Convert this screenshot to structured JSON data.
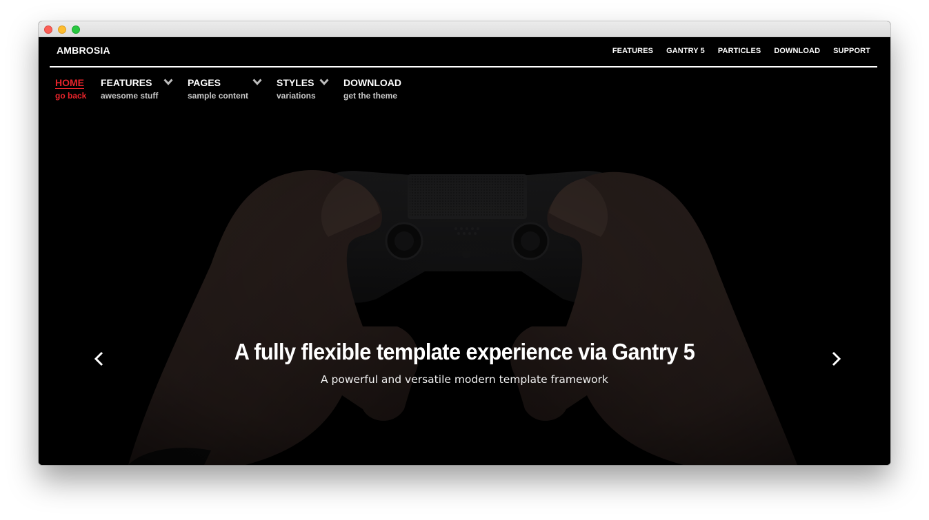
{
  "site": {
    "logo": "AMBROSIA"
  },
  "top_nav": {
    "links": [
      "FEATURES",
      "GANTRY 5",
      "PARTICLES",
      "DOWNLOAD",
      "SUPPORT"
    ]
  },
  "main_nav": {
    "items": [
      {
        "title": "HOME",
        "subtitle": "go back",
        "active": true,
        "has_dropdown": false
      },
      {
        "title": "FEATURES",
        "subtitle": "awesome stuff",
        "active": false,
        "has_dropdown": true
      },
      {
        "title": "PAGES",
        "subtitle": "sample content",
        "active": false,
        "has_dropdown": true
      },
      {
        "title": "STYLES",
        "subtitle": "variations",
        "active": false,
        "has_dropdown": true
      },
      {
        "title": "DOWNLOAD",
        "subtitle": "get the theme",
        "active": false,
        "has_dropdown": false
      }
    ]
  },
  "hero": {
    "title": "A fully flexible template experience via Gantry 5",
    "subtitle": "A powerful and versatile modern template framework",
    "prev_icon": "chevron-left-icon",
    "next_icon": "chevron-right-icon"
  },
  "colors": {
    "accent": "#e8242b",
    "background": "#000000",
    "text": "#ffffff"
  }
}
